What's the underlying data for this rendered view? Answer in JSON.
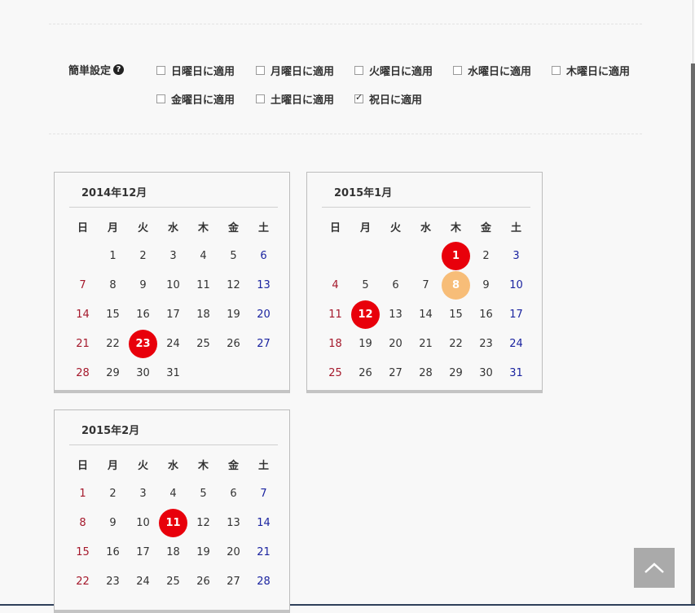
{
  "settings": {
    "label": "簡単設定",
    "help_icon": "?",
    "options": [
      {
        "label": "日曜日に適用",
        "checked": false
      },
      {
        "label": "月曜日に適用",
        "checked": false
      },
      {
        "label": "火曜日に適用",
        "checked": false
      },
      {
        "label": "水曜日に適用",
        "checked": false
      },
      {
        "label": "木曜日に適用",
        "checked": false
      },
      {
        "label": "金曜日に適用",
        "checked": false
      },
      {
        "label": "土曜日に適用",
        "checked": false
      },
      {
        "label": "祝日に適用",
        "checked": true
      }
    ]
  },
  "weekdays": [
    "日",
    "月",
    "火",
    "水",
    "木",
    "金",
    "土"
  ],
  "calendars": [
    {
      "title": "2014年12月",
      "first_weekday": 1,
      "days": 31,
      "holidays": [
        23
      ],
      "today": null,
      "visible_rows": 5
    },
    {
      "title": "2015年1月",
      "first_weekday": 4,
      "days": 31,
      "holidays": [
        1,
        12
      ],
      "today": 8,
      "visible_rows": 5
    },
    {
      "title": "2015年2月",
      "first_weekday": 0,
      "days": 28,
      "holidays": [
        11
      ],
      "today": null,
      "visible_rows": 4
    }
  ],
  "colors": {
    "holiday": "#e8000b",
    "today": "#f7bd78",
    "sunday": "#a5192c",
    "saturday": "#1b24a0"
  },
  "icons": {
    "help": "question-circle-icon",
    "back_to_top": "chevron-up-icon"
  }
}
